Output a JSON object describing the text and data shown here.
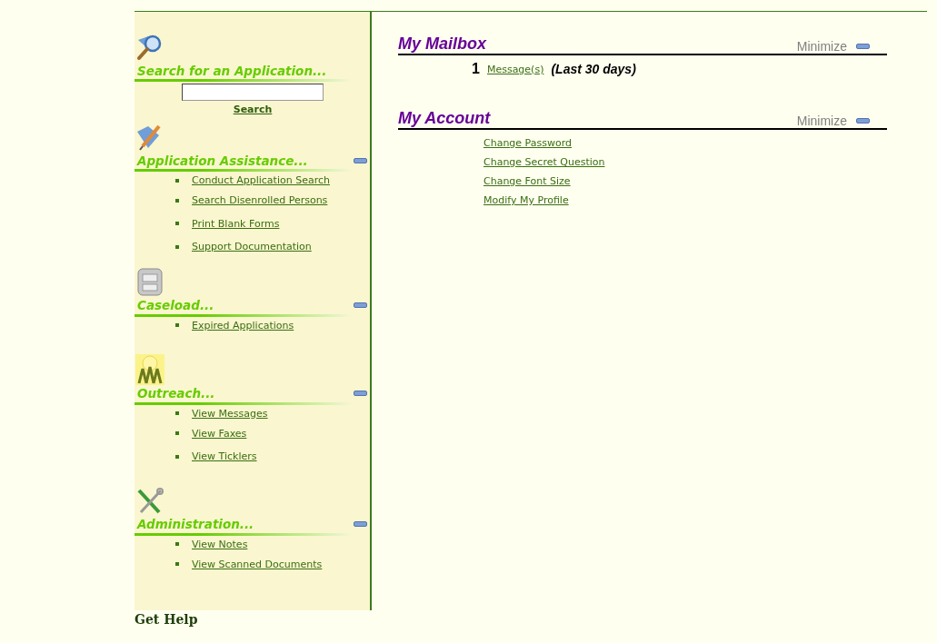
{
  "sidebar": {
    "sections": [
      {
        "kind": "search",
        "title": "Search for an Application...",
        "minimizable": false,
        "search": {
          "button": "Search"
        }
      },
      {
        "kind": "assistance",
        "title": "Application Assistance...",
        "minimizable": true,
        "links": [
          "Conduct Application Search",
          "Search Disenrolled Persons",
          "Print Blank Forms",
          "Support Documentation"
        ]
      },
      {
        "kind": "caseload",
        "title": "Caseload...",
        "minimizable": true,
        "links": [
          "Expired Applications"
        ]
      },
      {
        "kind": "outreach",
        "title": "Outreach...",
        "minimizable": true,
        "links": [
          "View Messages",
          "View Faxes",
          "View Ticklers"
        ]
      },
      {
        "kind": "administration",
        "title": "Administration...",
        "minimizable": true,
        "links": [
          "View Notes",
          "View Scanned Documents"
        ]
      }
    ]
  },
  "panels": [
    {
      "kind": "mailbox",
      "title": "My Mailbox",
      "minimize": "Minimize",
      "count": "1",
      "link": "Message(s)",
      "note": "(Last 30 days)"
    },
    {
      "kind": "account",
      "title": "My Account",
      "minimize": "Minimize",
      "links": [
        "Change Password",
        "Change Secret Question",
        "Change Font Size",
        "Modify My Profile"
      ]
    }
  ],
  "footer": {
    "help": "Get Help"
  }
}
